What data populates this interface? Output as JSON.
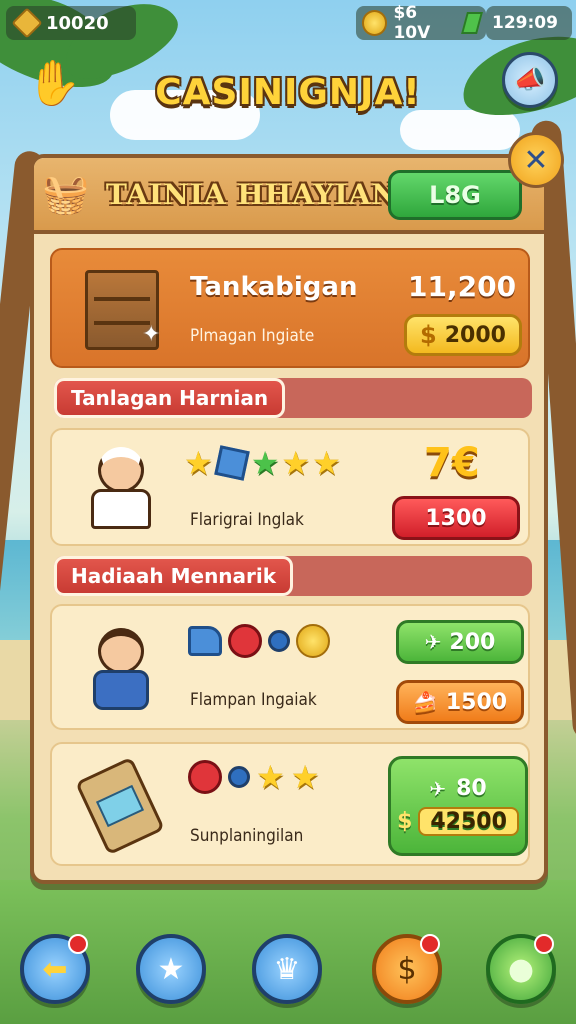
{
  "top_bar": {
    "gems": "10020",
    "currency": "$6 10V",
    "clock": "129:09"
  },
  "title": "CASINIGNJA!",
  "panel": {
    "title": "TAINIA HHAYIAN",
    "log_button": "L8G"
  },
  "featured": {
    "name": "Tankabigan",
    "amount": "11,200",
    "subtitle": "Plmagan Ingiate",
    "price": "2000",
    "price_icon": "$"
  },
  "sections": {
    "daily": "Tanlagan Harnian",
    "rewards": "Hadiaah Mennarik"
  },
  "daily_item": {
    "subtitle": "Flarigrai Inglak",
    "value": "7€",
    "button": "1300"
  },
  "reward_items": [
    {
      "subtitle": "Flampan Ingaiak",
      "button_top": "200",
      "button_bottom": "1500"
    },
    {
      "subtitle": "Sunplaningilan",
      "button_top": "80",
      "button_bottom": "42500"
    }
  ],
  "colors": {
    "accent_gold": "#ffd33a",
    "panel": "#f3dfb4",
    "green": "#4cb53a",
    "red": "#d11f2a"
  }
}
